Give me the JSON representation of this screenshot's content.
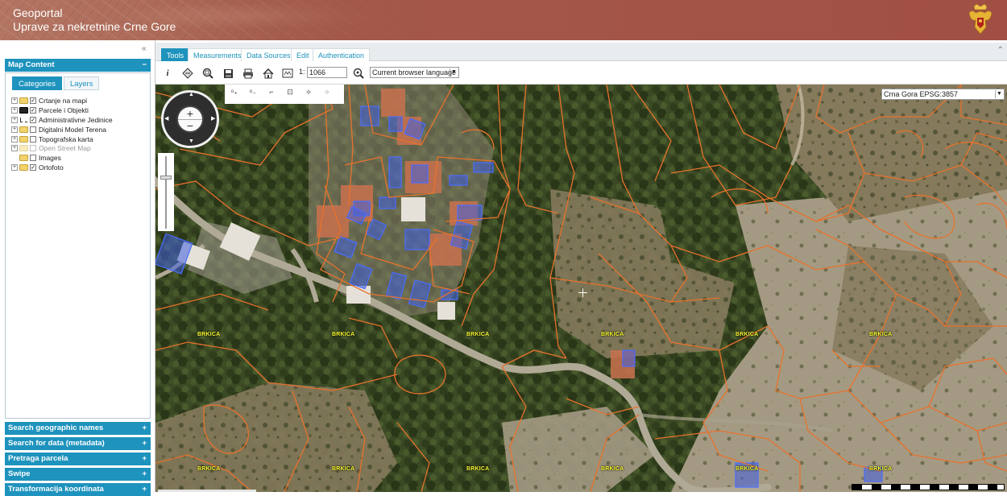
{
  "header": {
    "title_line1": "Geoportal",
    "title_line2": "Uprave za nekretnine Crne Gore"
  },
  "left_panel": {
    "map_content": {
      "title": "Map Content",
      "toggle": "−",
      "tabs": [
        {
          "label": "Categories",
          "active": true
        },
        {
          "label": "Layers",
          "active": false
        }
      ],
      "layers": [
        {
          "label": "Crtanje na mapi",
          "checked": true,
          "expandable": true,
          "enabled": true,
          "icon": "folder-icon"
        },
        {
          "label": "Parcele i Objekti",
          "checked": true,
          "expandable": true,
          "enabled": true,
          "icon": "layer-style-icon"
        },
        {
          "label": "Administrativne Jedinice",
          "checked": true,
          "expandable": true,
          "enabled": true,
          "icon": "boundary-style-icon"
        },
        {
          "label": "Digitalni Model Terena",
          "checked": false,
          "expandable": true,
          "enabled": true,
          "icon": "folder-icon"
        },
        {
          "label": "Topografska karta",
          "checked": false,
          "expandable": true,
          "enabled": true,
          "icon": "folder-icon"
        },
        {
          "label": "Open Street Map",
          "checked": false,
          "expandable": true,
          "enabled": false,
          "icon": "folder-icon"
        },
        {
          "label": "Images",
          "checked": false,
          "expandable": false,
          "enabled": true,
          "icon": "folder-icon"
        },
        {
          "label": "Ortofoto",
          "checked": true,
          "expandable": true,
          "enabled": true,
          "icon": "folder-icon"
        }
      ]
    },
    "sections": [
      {
        "label": "Search geographic names",
        "toggle": "+"
      },
      {
        "label": "Search for data (metadata)",
        "toggle": "+"
      },
      {
        "label": "Pretraga parcela",
        "toggle": "+"
      },
      {
        "label": "Swipe",
        "toggle": "+"
      },
      {
        "label": "Transformacija koordinata",
        "toggle": "+"
      }
    ]
  },
  "toolbar": {
    "tabs": [
      {
        "label": "Tools",
        "active": true
      },
      {
        "label": "Measurements",
        "active": false
      },
      {
        "label": "Data Sources",
        "active": false
      },
      {
        "label": "Edit",
        "active": false
      },
      {
        "label": "Authentication",
        "active": false
      }
    ],
    "tools": [
      "info-icon",
      "layer-select-icon",
      "zoom-box-icon",
      "save-icon",
      "print-icon",
      "home-icon",
      "zoom-scale-icon"
    ],
    "scale_prefix": "1:",
    "scale_value": "1066",
    "language": "Current browser language"
  },
  "map": {
    "crs": "Crna Gora EPSG:3857",
    "parcel_label": "BRKICA",
    "colors": {
      "parcel_outline": "#e8722c",
      "building_fill": "#3f5bd9",
      "label": "#ffff33",
      "panel_accent": "#1e93bd"
    }
  }
}
